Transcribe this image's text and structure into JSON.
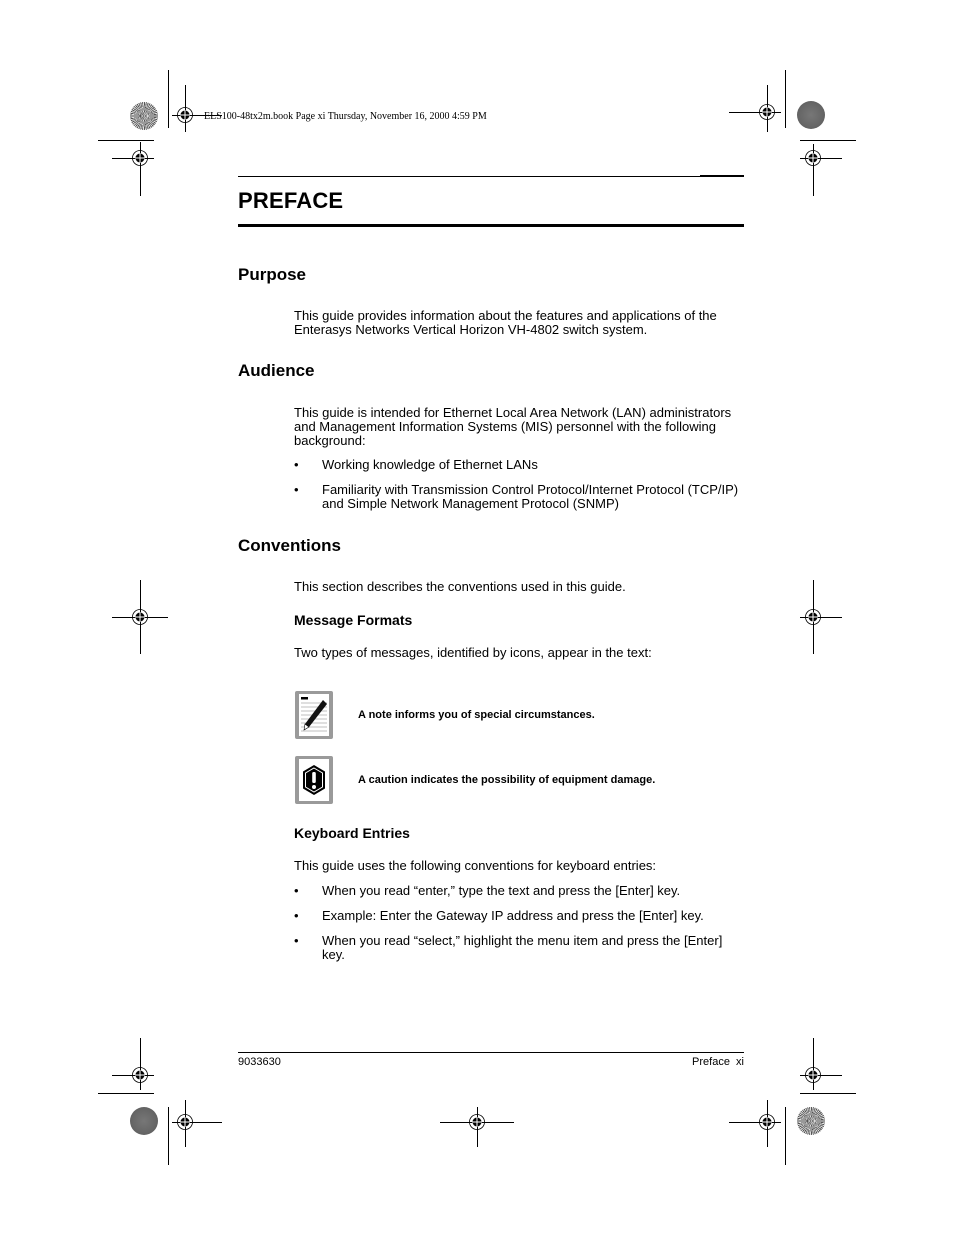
{
  "print_header": "ELS100-48tx2m.book  Page xi  Thursday, November 16, 2000  4:59 PM",
  "page_title": "PREFACE",
  "sections": {
    "purpose": {
      "heading": "Purpose",
      "body": "This guide provides information about the features and applications of the Enterasys Networks Vertical Horizon VH-4802 switch system."
    },
    "audience": {
      "heading": "Audience",
      "body": "This guide is intended for Ethernet Local Area Network (LAN) administrators and Management Information Systems (MIS) personnel with the following background:",
      "bullets": [
        "Working knowledge of Ethernet LANs",
        "Familiarity with Transmission Control Protocol/Internet Protocol (TCP/IP) and Simple Network Management Protocol (SNMP)"
      ]
    },
    "conventions": {
      "heading": "Conventions",
      "body": "This section describes the conventions used in this guide.",
      "message_formats": {
        "heading": "Message Formats",
        "body": "Two types of messages, identified by icons, appear in the text:",
        "messages": [
          {
            "icon": "note-pencil-icon",
            "text": "A note informs you of special circumstances."
          },
          {
            "icon": "caution-exclamation-icon",
            "text": "A caution indicates the possibility of equipment damage."
          }
        ]
      },
      "keyboard_entries": {
        "heading": "Keyboard Entries",
        "body": "This guide uses the following conventions for keyboard entries:",
        "bullets": [
          "When you read “enter,” type the text and press the [Enter] key.",
          "Example: Enter the Gateway IP address and press the [Enter] key.",
          "When you read “select,” highlight the menu item and press the [Enter] key."
        ]
      }
    }
  },
  "bullet_glyph": "•",
  "footer": {
    "doc_number": "9033630",
    "page_label": "Preface  xi"
  }
}
